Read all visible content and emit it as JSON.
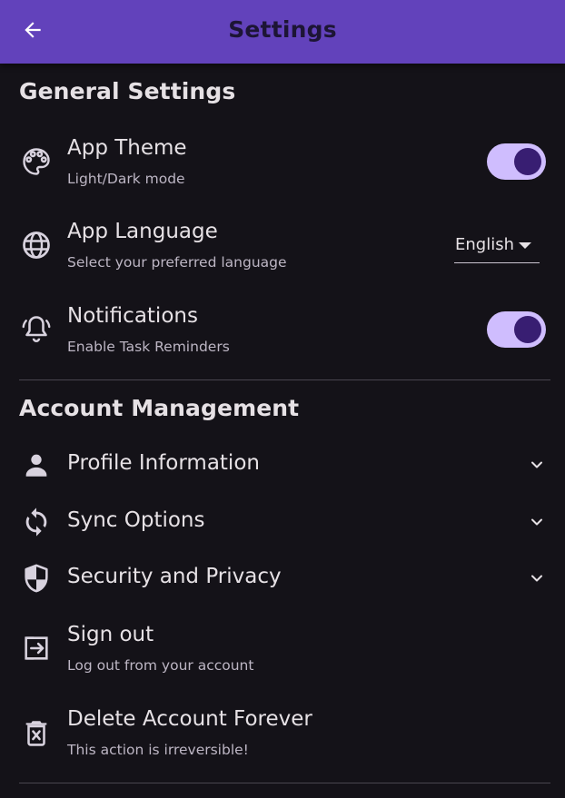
{
  "appbar": {
    "title": "Settings",
    "back_icon": "arrow-back-icon",
    "color": "#6242bb"
  },
  "general": {
    "title": "General Settings",
    "theme": {
      "icon": "palette-icon",
      "title": "App Theme",
      "subtitle": "Light/Dark mode",
      "enabled": true
    },
    "language": {
      "icon": "globe-icon",
      "title": "App Language",
      "subtitle": "Select your preferred language",
      "selected": "English"
    },
    "notifications": {
      "icon": "bell-icon",
      "title": "Notifications",
      "subtitle": "Enable Task Reminders",
      "enabled": true
    }
  },
  "account": {
    "title": "Account Management",
    "profile": {
      "icon": "person-icon",
      "title": "Profile Information"
    },
    "sync": {
      "icon": "sync-icon",
      "title": "Sync Options"
    },
    "security": {
      "icon": "shield-icon",
      "title": "Security and Privacy"
    },
    "signout": {
      "icon": "exit-icon",
      "title": "Sign out",
      "subtitle": "Log out from your account"
    },
    "delete": {
      "icon": "delete-forever-icon",
      "title": "Delete Account Forever",
      "subtitle": "This action is irreversible!"
    }
  },
  "colors": {
    "background": "#141218",
    "toggle_track": "#cfbdfe",
    "toggle_knob": "#381e72",
    "text": "#e6e1e5",
    "subtext": "#bdb6c4"
  }
}
